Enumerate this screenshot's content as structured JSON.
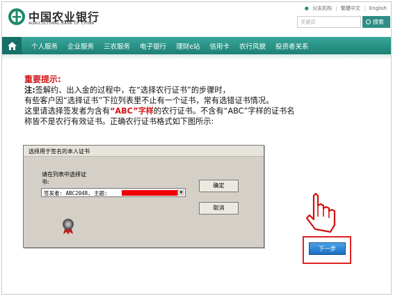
{
  "header": {
    "brand_cn": "中国农业银行",
    "brand_en": "AGRICULTURAL BANK OF CHINA",
    "top_links": [
      "分支机构",
      "繁體中文",
      "English"
    ],
    "search_placeholder": "关键词",
    "search_button": "搜索"
  },
  "nav": {
    "items": [
      "个人服务",
      "企业服务",
      "三农服务",
      "电子银行",
      "理财e站",
      "信用卡",
      "农行风貌",
      "投资者关系"
    ]
  },
  "notice": {
    "title": "重要提示:",
    "note_label": "注:",
    "line1": "签解约、出入金的过程中，在“选择农行证书”的步骤时，",
    "line2": "有些客户因“选择证书”下拉列表里不止有一个证书，常有选错证书情况。",
    "line3_pre": "这里请选择签发者为含有",
    "line3_abc": "“ABC”字样",
    "line3_post": "的农行证书。不含有“ABC”字样的证书名",
    "line4": "称皆不是农行有效证书。正确农行证书格式如下图所示:"
  },
  "dialog": {
    "title": "选择用于签名的本人证书",
    "label_line1": "请在列表中选择证",
    "label_line2": "书:",
    "combo_value": "签发者: ABC2048, 主题:",
    "ok_button": "确定",
    "cancel_button": "取消"
  },
  "next_button": "下一步",
  "colors": {
    "accent": "#2f8d86",
    "warning": "#d21414",
    "button_blue": "#1b6dc0"
  }
}
